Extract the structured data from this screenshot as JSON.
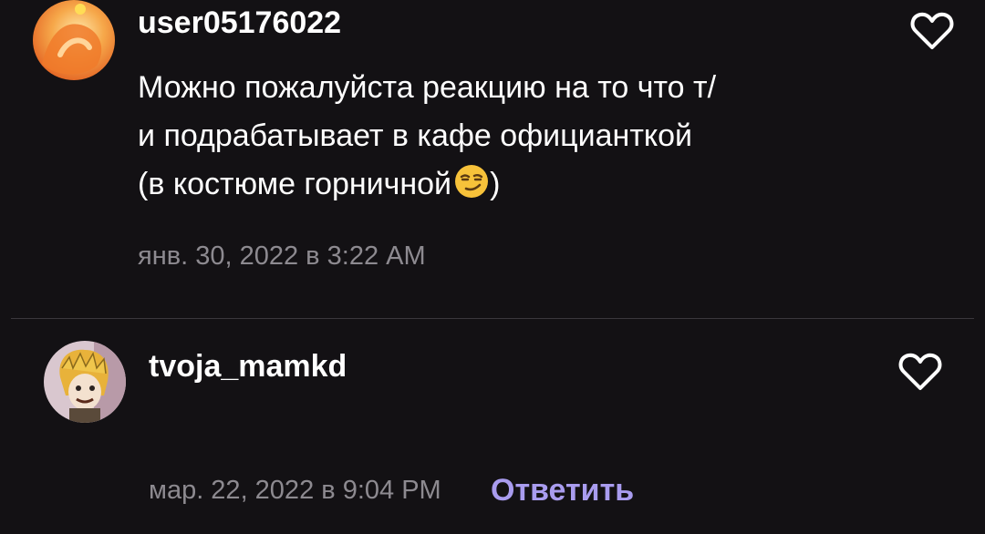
{
  "comments": [
    {
      "username": "user05176022",
      "lines": [
        "Можно пожалуйста реакцию на то что т/",
        "и подрабатывает в кафе официанткой",
        "(в костюме горничной"
      ],
      "line_suffix": ")",
      "emoji": "smirking-face",
      "timestamp": "янв. 30, 2022 в 3:22 AM",
      "avatar_colors": [
        "#f6c27a",
        "#f07a2a",
        "#ffe7a8"
      ]
    },
    {
      "username": "tvoja_mamkd",
      "lines": [
        ""
      ],
      "timestamp": "мар. 22, 2022 в 9:04 PM",
      "reply_label": "Ответить",
      "avatar_colors": [
        "#d9c7cf",
        "#e8b23a",
        "#5a4a3a"
      ]
    }
  ],
  "colors": {
    "background": "#131114",
    "text": "#ffffff",
    "meta": "#8d8a90",
    "accent": "#a99cef",
    "divider": "#3a373c"
  },
  "icons": {
    "like": "heart-outline-icon"
  }
}
